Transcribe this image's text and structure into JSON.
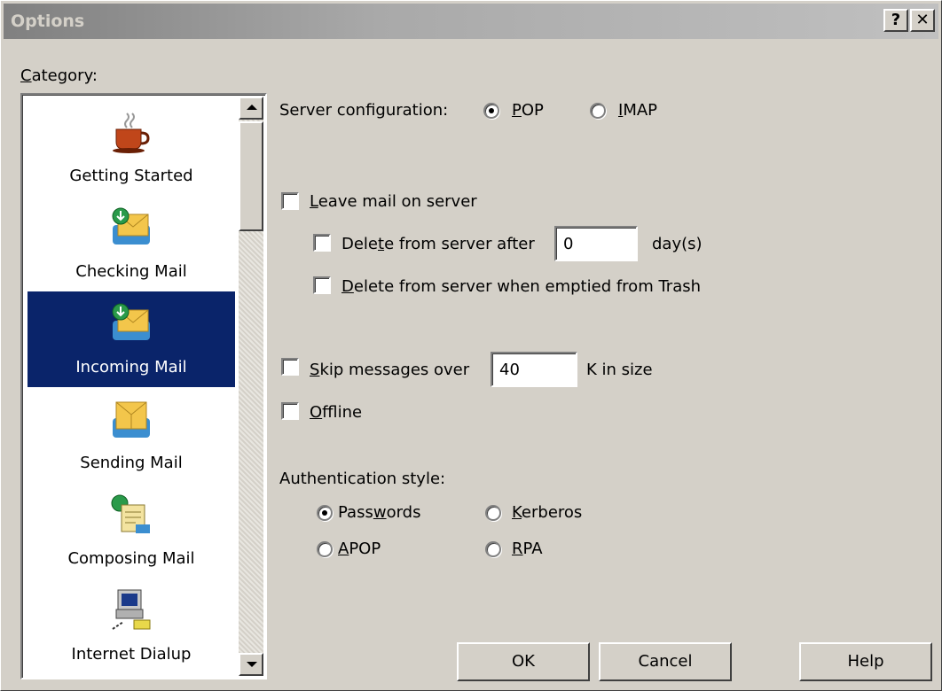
{
  "window": {
    "title": "Options",
    "help_button": "?",
    "close_button": "✕"
  },
  "category": {
    "label_prefix": "",
    "label_accel": "C",
    "label_rest": "ategory:",
    "items": [
      {
        "label": "Getting Started",
        "icon": "coffee-cup-icon"
      },
      {
        "label": "Checking Mail",
        "icon": "mail-download-icon"
      },
      {
        "label": "Incoming Mail",
        "icon": "incoming-mail-icon",
        "selected": true
      },
      {
        "label": "Sending Mail",
        "icon": "sending-mail-icon"
      },
      {
        "label": "Composing Mail",
        "icon": "compose-mail-icon"
      },
      {
        "label": "Internet Dialup",
        "icon": "dialup-computer-icon"
      }
    ]
  },
  "server_config": {
    "label": "Server configuration:",
    "pop": {
      "accel": "P",
      "rest": "OP",
      "checked": true
    },
    "imap": {
      "accel": "I",
      "rest": "MAP",
      "checked": false
    }
  },
  "leave_mail": {
    "accel": "L",
    "rest": "eave mail on server",
    "checked": false
  },
  "delete_after": {
    "pre": "Dele",
    "accel": "t",
    "rest": "e from server after",
    "value": "0",
    "suffix": "day(s)",
    "checked": false
  },
  "delete_trash": {
    "accel": "D",
    "rest": "elete from server when emptied from Trash",
    "checked": false
  },
  "skip_messages": {
    "accel": "S",
    "rest": "kip messages over",
    "value": "40",
    "suffix": "K in size",
    "checked": false
  },
  "offline": {
    "accel": "O",
    "rest": "ffline",
    "checked": false
  },
  "auth": {
    "label": "Authentication style:",
    "passwords": {
      "pre": "Pass",
      "accel": "w",
      "rest": "ords",
      "checked": true
    },
    "kerberos": {
      "accel": "K",
      "rest": "erberos",
      "checked": false
    },
    "apop": {
      "accel": "A",
      "rest": "POP",
      "checked": false
    },
    "rpa": {
      "accel": "R",
      "rest": "PA",
      "checked": false
    }
  },
  "buttons": {
    "ok": "OK",
    "cancel": "Cancel",
    "help": "Help"
  }
}
